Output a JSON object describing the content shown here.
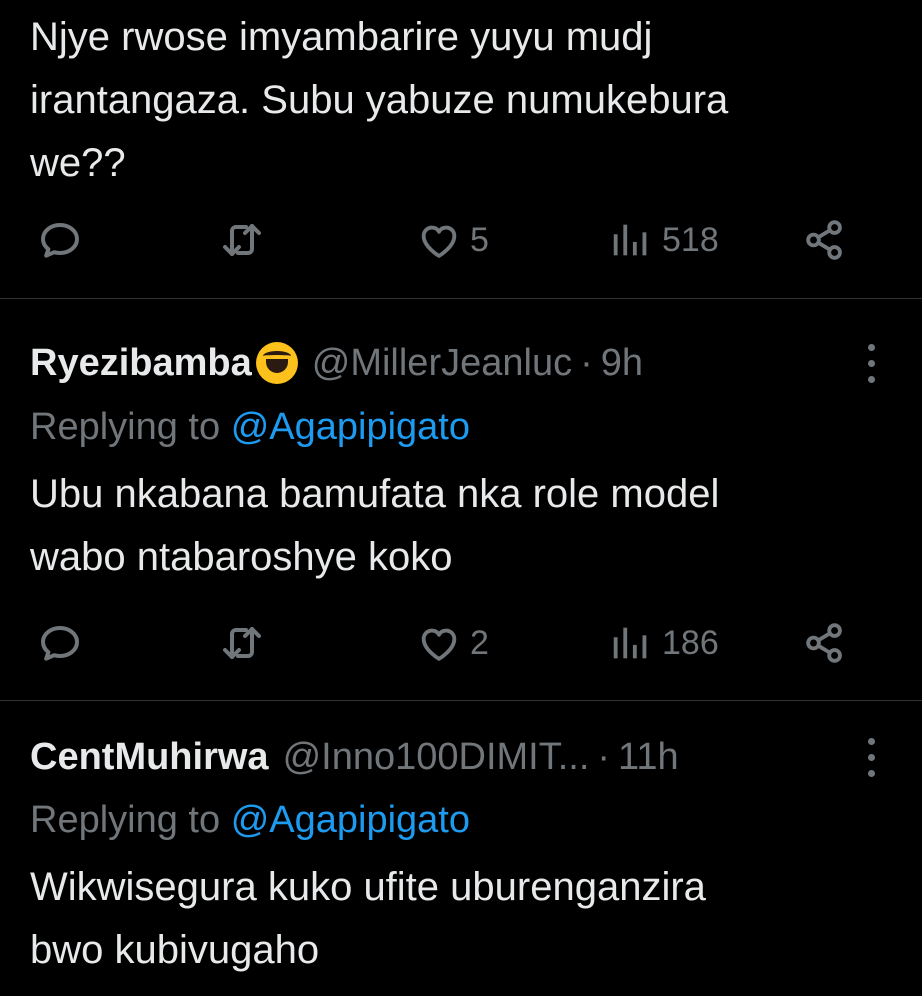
{
  "tweets": [
    {
      "text": "Njye rwose imyambarire yuyu mudj\nirantangaza. Subu yabuze numukebura\nwe??",
      "likes": "5",
      "views": "518"
    },
    {
      "display_name": "Ryezibamba",
      "name_emoji": "rolling-on-floor-laughing-emoji",
      "handle": "@MillerJeanluc",
      "separator": "·",
      "time": "9h",
      "replying_prefix": "Replying to",
      "replying_to": "@Agapipigato",
      "text": "Ubu nkabana bamufata nka role model\nwabo ntabaroshye koko",
      "likes": "2",
      "views": "186"
    },
    {
      "display_name": "CentMuhirwa",
      "handle": "@Inno100DIMIT...",
      "separator": "·",
      "time": "11h",
      "replying_prefix": "Replying to",
      "replying_to": "@Agapipigato",
      "text": "Wikwisegura kuko ufite uburenganzira\nbwo kubivugaho"
    }
  ],
  "icons": {
    "reply": "reply-icon",
    "retweet": "retweet-icon",
    "like": "heart-icon",
    "views": "views-icon",
    "share": "share-icon",
    "more": "more-icon"
  },
  "colors": {
    "background": "#000000",
    "text": "#e7e9ea",
    "muted": "#71767b",
    "link": "#1d9bf0",
    "divider": "#2f3336"
  }
}
